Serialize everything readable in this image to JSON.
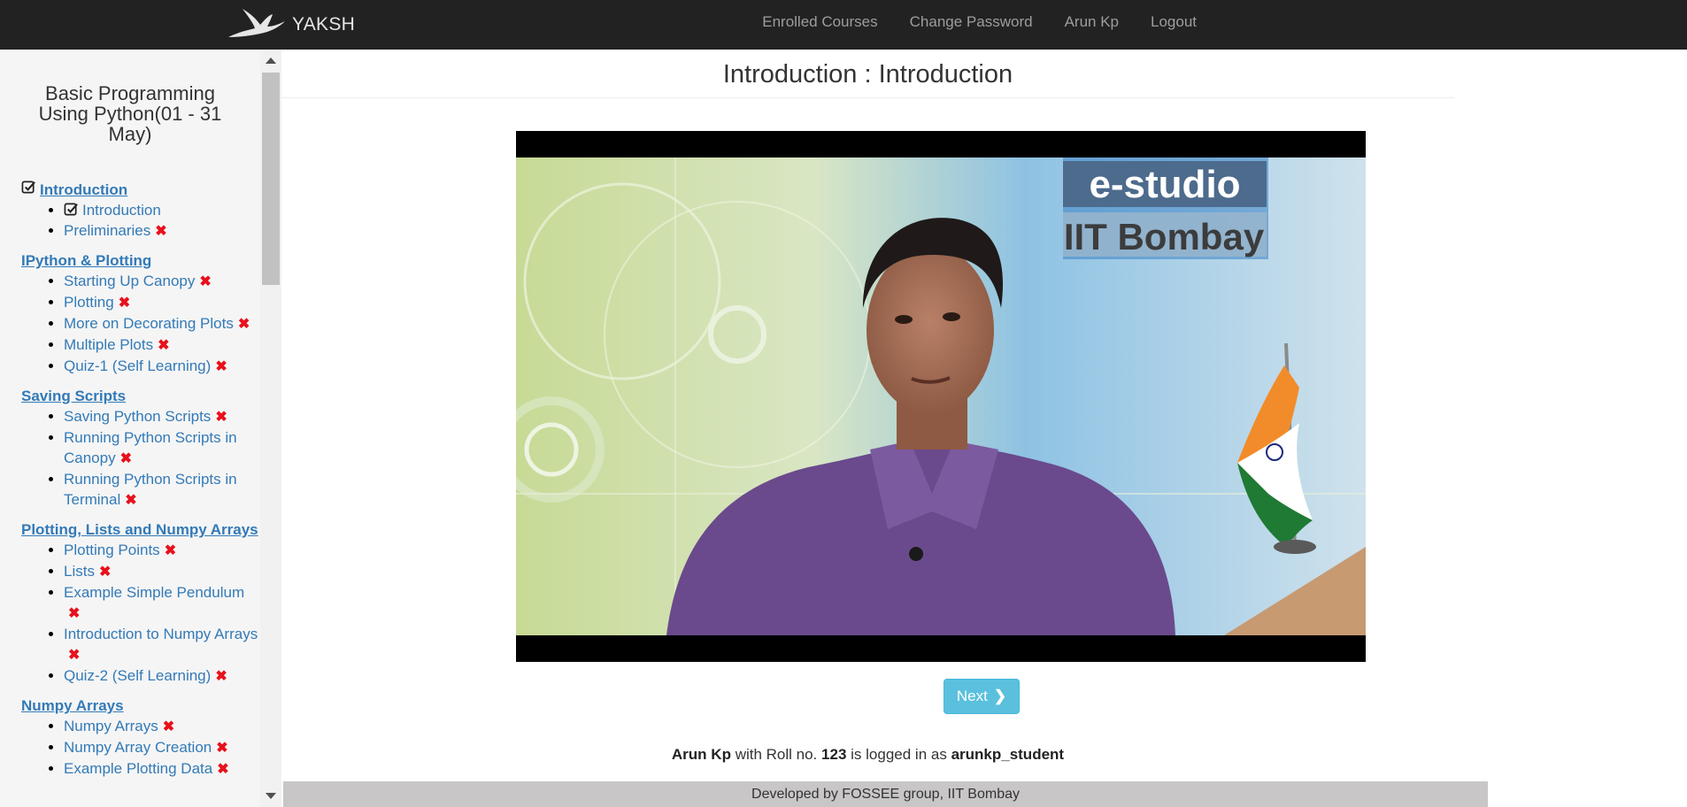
{
  "navbar": {
    "brand": "YAKSH",
    "links": [
      "Enrolled Courses",
      "Change Password",
      "Arun Kp",
      "Logout"
    ]
  },
  "sidebar": {
    "course_title": "Basic Programming Using Python(01 - 31 May)",
    "modules": [
      {
        "name": "Introduction",
        "completed": true,
        "units": [
          {
            "name": "Introduction",
            "completed": true
          },
          {
            "name": "Preliminaries",
            "completed": false
          }
        ]
      },
      {
        "name": "IPython & Plotting",
        "completed": false,
        "units": [
          {
            "name": "Starting Up Canopy",
            "completed": false
          },
          {
            "name": "Plotting",
            "completed": false
          },
          {
            "name": "More on Decorating Plots",
            "completed": false
          },
          {
            "name": "Multiple Plots",
            "completed": false
          },
          {
            "name": "Quiz-1 (Self Learning)",
            "completed": false
          }
        ]
      },
      {
        "name": "Saving Scripts",
        "completed": false,
        "units": [
          {
            "name": "Saving Python Scripts",
            "completed": false
          },
          {
            "name": "Running Python Scripts in Canopy",
            "completed": false
          },
          {
            "name": "Running Python Scripts in Terminal",
            "completed": false
          }
        ]
      },
      {
        "name": "Plotting, Lists and Numpy Arrays",
        "completed": false,
        "units": [
          {
            "name": "Plotting Points",
            "completed": false
          },
          {
            "name": "Lists",
            "completed": false
          },
          {
            "name": "Example Simple Pendulum",
            "completed": false
          },
          {
            "name": "Introduction to Numpy Arrays",
            "completed": false
          },
          {
            "name": "Quiz-2 (Self Learning)",
            "completed": false
          }
        ]
      },
      {
        "name": "Numpy Arrays",
        "completed": false,
        "units": [
          {
            "name": "Numpy Arrays",
            "completed": false
          },
          {
            "name": "Numpy Array Creation",
            "completed": false
          },
          {
            "name": "Example Plotting Data",
            "completed": false
          }
        ]
      }
    ],
    "incomplete_mark": "✖"
  },
  "main": {
    "title": "Introduction : Introduction",
    "video": {
      "studio_line1": "e-studio",
      "studio_line2": "IIT Bombay"
    },
    "next_label": "Next",
    "next_icon": "chevron-right-icon",
    "login": {
      "name": "Arun Kp",
      "text1": "with Roll no.",
      "roll": "123",
      "text2": "is logged in as",
      "username": "arunkp_student"
    }
  },
  "footer": {
    "text": "Developed by FOSSEE group, IIT Bombay"
  },
  "colors": {
    "navbar_bg": "#222222",
    "link": "#337ab7",
    "incomplete": "#e8101b",
    "next_button": "#5bc0de"
  }
}
